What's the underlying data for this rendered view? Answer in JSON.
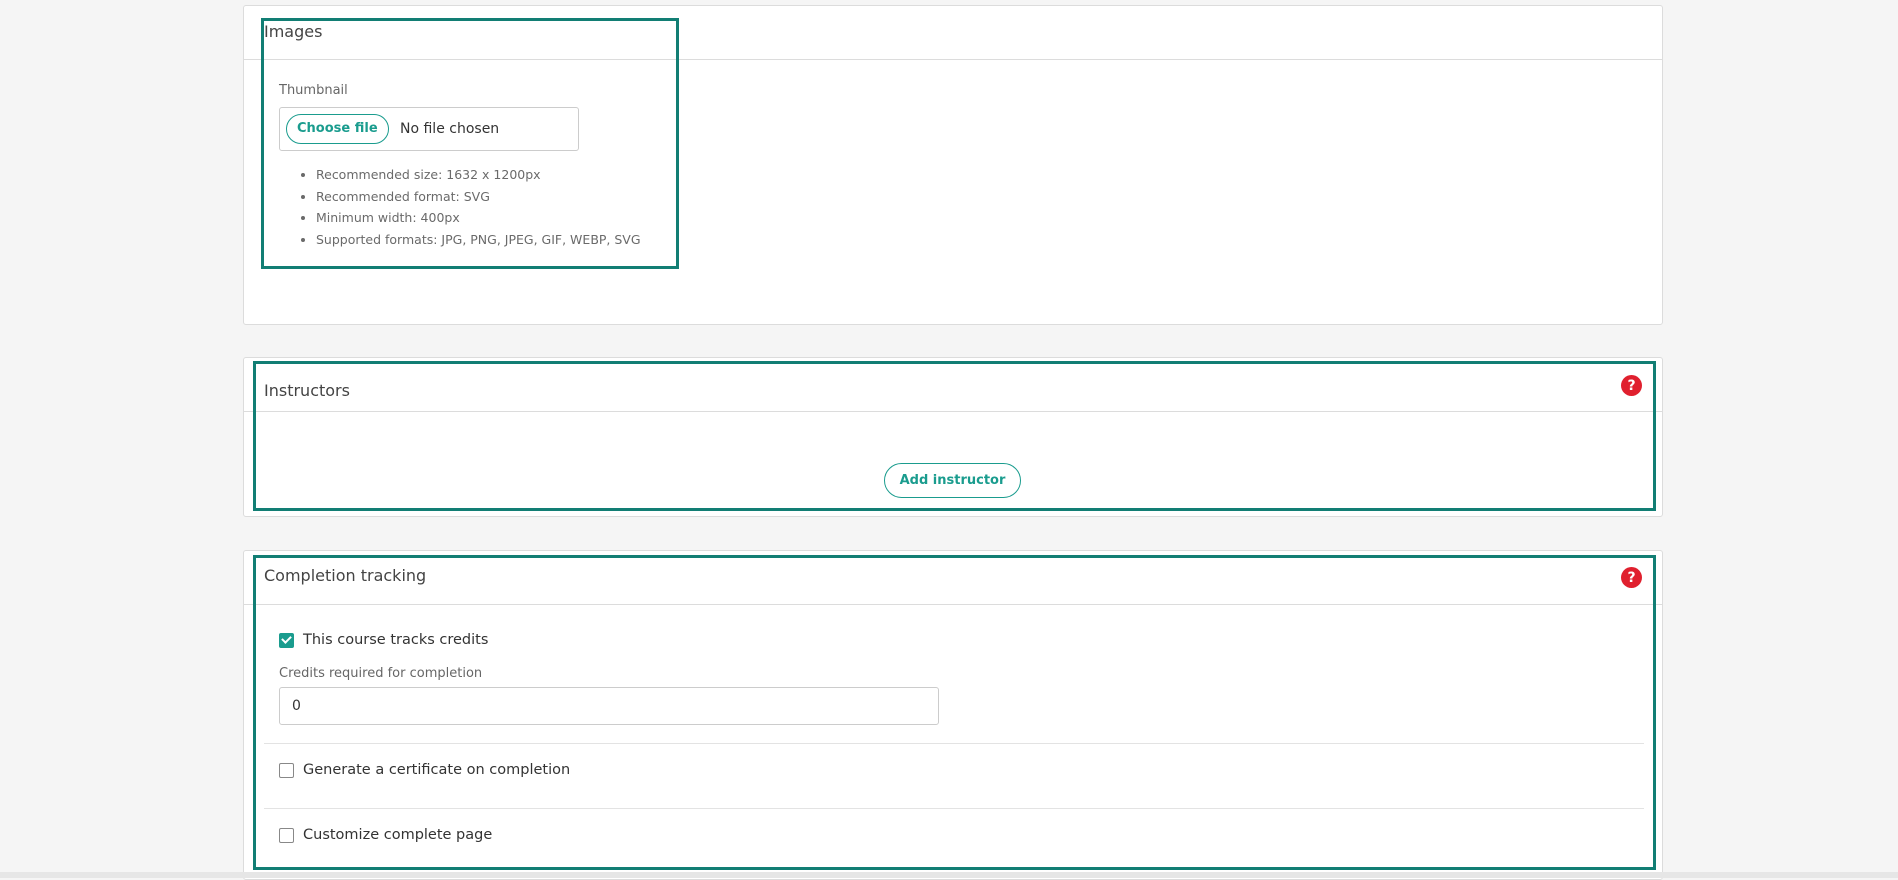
{
  "images": {
    "title": "Images",
    "thumbnail_label": "Thumbnail",
    "choose_file_label": "Choose file",
    "no_file_text": "No file chosen",
    "hints": [
      "Recommended size: 1632 x 1200px",
      "Recommended format: SVG",
      "Minimum width: 400px",
      "Supported formats: JPG, PNG, JPEG, GIF, WEBP, SVG"
    ]
  },
  "instructors": {
    "title": "Instructors",
    "help_icon": "question-icon",
    "help_glyph": "?",
    "add_button_label": "Add instructor"
  },
  "completion": {
    "title": "Completion tracking",
    "help_glyph": "?",
    "tracks_credits_label": "This course tracks credits",
    "tracks_credits_checked": true,
    "credits_label": "Credits required for completion",
    "credits_value": "0",
    "certificate_label": "Generate a certificate on completion",
    "certificate_checked": false,
    "customize_label": "Customize complete page",
    "customize_checked": false
  },
  "colors": {
    "accent": "#1a9c8e",
    "highlight": "#127e74",
    "help": "#e0202e"
  }
}
